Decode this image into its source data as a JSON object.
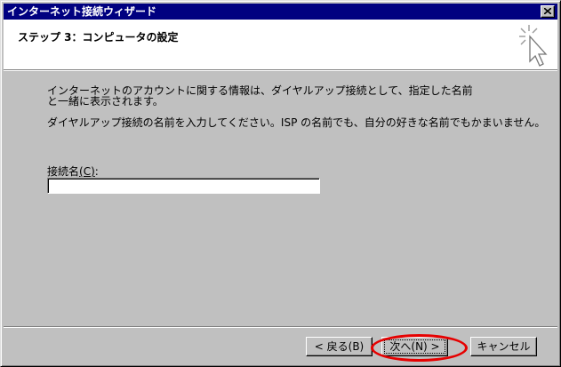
{
  "window": {
    "title": "インターネット接続ウィザード"
  },
  "header": {
    "title": "ステップ 3：コンピュータの設定"
  },
  "body": {
    "description_1": "インターネットのアカウントに関する情報は、ダイヤルアップ接続として、指定した名前と一緒に表示されます。",
    "description_2": "ダイヤルアップ接続の名前を入力してください。ISP の名前でも、自分の好きな名前でもかまいません。",
    "connection_name_label": "接続名",
    "connection_name_accel": "(C)",
    "connection_name_suffix": ":",
    "connection_name_value": ""
  },
  "buttons": {
    "back_label": "< 戻る(B)",
    "next_label": "次へ(N) >",
    "cancel_label": "キャンセル"
  },
  "icons": {
    "close": "close-icon",
    "wizard": "wizard-cursor-icon"
  },
  "annotation": {
    "highlight_color": "#e60000",
    "highlighted_target": "next-button"
  }
}
